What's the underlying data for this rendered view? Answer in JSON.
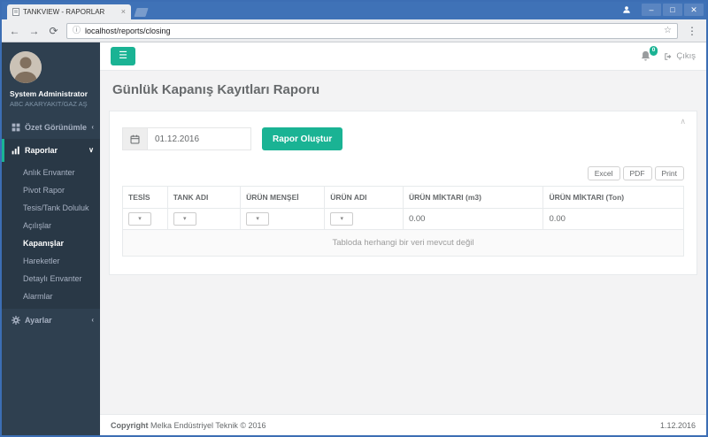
{
  "browser": {
    "tab_title": "TANKVIEW - RAPORLAR",
    "url": "localhost/reports/closing"
  },
  "icons": {
    "back": "←",
    "forward": "→",
    "reload": "⟳",
    "info": "ⓘ",
    "star": "☆",
    "menu_dots": "⋮",
    "minimize": "–",
    "maximize": "□",
    "close": "✕",
    "tab_close": "×",
    "hamburger": "☰",
    "chevron_left": "‹",
    "chevron_down": "∨",
    "collapse_up": "∧",
    "select_caret": "▾"
  },
  "colors": {
    "accent": "#1ab394",
    "sidebar": "#2f4050",
    "titlebar": "#3f72b7"
  },
  "sidebar": {
    "user": {
      "name": "System Administrator",
      "company": "ABC AKARYAKIT/GAZ AŞ"
    },
    "menu": [
      {
        "label": "Özet Görünümler"
      },
      {
        "label": "Raporlar"
      },
      {
        "label": "Ayarlar"
      }
    ],
    "submenu": [
      "Anlık Envanter",
      "Pivot Rapor",
      "Tesis/Tank Doluluk",
      "Açılışlar",
      "Kapanışlar",
      "Hareketler",
      "Detaylı Envanter",
      "Alarmlar"
    ],
    "active_item": "Kapanışlar"
  },
  "topbar": {
    "badge": "0",
    "logout": "Çıkış"
  },
  "page": {
    "title": "Günlük Kapanış Kayıtları Raporu"
  },
  "panel": {
    "date_value": "01.12.2016",
    "generate_button": "Rapor Oluştur",
    "export": {
      "excel": "Excel",
      "pdf": "PDF",
      "print": "Print"
    }
  },
  "table": {
    "headers": [
      "TESİS",
      "TANK ADI",
      "ÜRÜN MENŞEİ",
      "ÜRÜN ADI",
      "ÜRÜN MİKTARI (m3)",
      "ÜRÜN MİKTARI (Ton)"
    ],
    "totals": {
      "m3": "0.00",
      "ton": "0.00"
    },
    "empty_message": "Tabloda herhangi bir veri mevcut değil"
  },
  "footer": {
    "copyright_label": "Copyright",
    "copyright_text": " Melka Endüstriyel Teknik © 2016",
    "date": "1.12.2016"
  }
}
